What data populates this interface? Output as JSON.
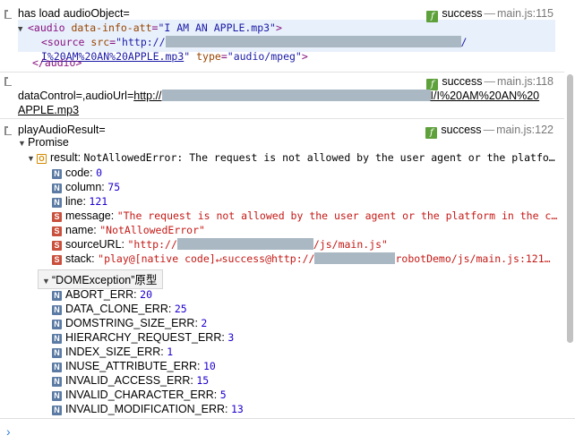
{
  "entry1": {
    "message": "has load audioObject=",
    "source_label": "success",
    "source_dash": "—",
    "source_file": "main.js:115",
    "audio_open_tag": "<audio",
    "audio_attr_name": "data-info-att",
    "audio_attr_value": "\"I AM AN APPLE.mp3\"",
    "audio_open_close": ">",
    "source_tag_open": "<source",
    "source_src_attr": "src",
    "source_src_start": "\"http://",
    "source_src_end": "/",
    "source_src_line2": "I%20AM%20AN%20APPLE.mp3",
    "source_src_line2_close": "\"",
    "source_type_attr": "type",
    "source_type_value": "\"audio/mpeg\"",
    "source_tag_close": ">",
    "audio_close_tag": "</audio>"
  },
  "entry2": {
    "source_label": "success",
    "source_dash": "—",
    "source_file": "main.js:118",
    "message_prefix": "dataControl=,audioUrl=",
    "url_start": "http://",
    "url_end": "I/I%20AM%20AN%20",
    "url_line2": "APPLE.mp3"
  },
  "entry3": {
    "message": "playAudioResult=",
    "source_label": "success",
    "source_dash": "—",
    "source_file": "main.js:122",
    "promise_label": "Promise",
    "result_key": "result:",
    "result_value": "NotAllowedError: The request is not allowed by the user agent or the platfo…",
    "props": [
      {
        "type": "N",
        "key": "code:",
        "value": "0"
      },
      {
        "type": "N",
        "key": "column:",
        "value": "75"
      },
      {
        "type": "N",
        "key": "line:",
        "value": "121"
      },
      {
        "type": "S",
        "key": "message:",
        "value": "\"The request is not allowed by the user agent or the platform in the c…"
      },
      {
        "type": "S",
        "key": "name:",
        "value": "\"NotAllowedError\""
      },
      {
        "type": "S",
        "key": "sourceURL:",
        "value_start": "\"http://",
        "value_end": "/js/main.js\""
      },
      {
        "type": "S",
        "key": "stack:",
        "value_start": "\"play@[native code]↵success@http://",
        "value_end": "robotDemo/js/main.js:121…"
      }
    ],
    "prototype_label": "“DOMException”原型",
    "constants": [
      {
        "key": "ABORT_ERR:",
        "value": "20"
      },
      {
        "key": "DATA_CLONE_ERR:",
        "value": "25"
      },
      {
        "key": "DOMSTRING_SIZE_ERR:",
        "value": "2"
      },
      {
        "key": "HIERARCHY_REQUEST_ERR:",
        "value": "3"
      },
      {
        "key": "INDEX_SIZE_ERR:",
        "value": "1"
      },
      {
        "key": "INUSE_ATTRIBUTE_ERR:",
        "value": "10"
      },
      {
        "key": "INVALID_ACCESS_ERR:",
        "value": "15"
      },
      {
        "key": "INVALID_CHARACTER_ERR:",
        "value": "5"
      },
      {
        "key": "INVALID_MODIFICATION_ERR:",
        "value": "13"
      }
    ]
  },
  "console": {
    "prompt_symbol": "›",
    "accent_color": "#2f7ed8"
  }
}
